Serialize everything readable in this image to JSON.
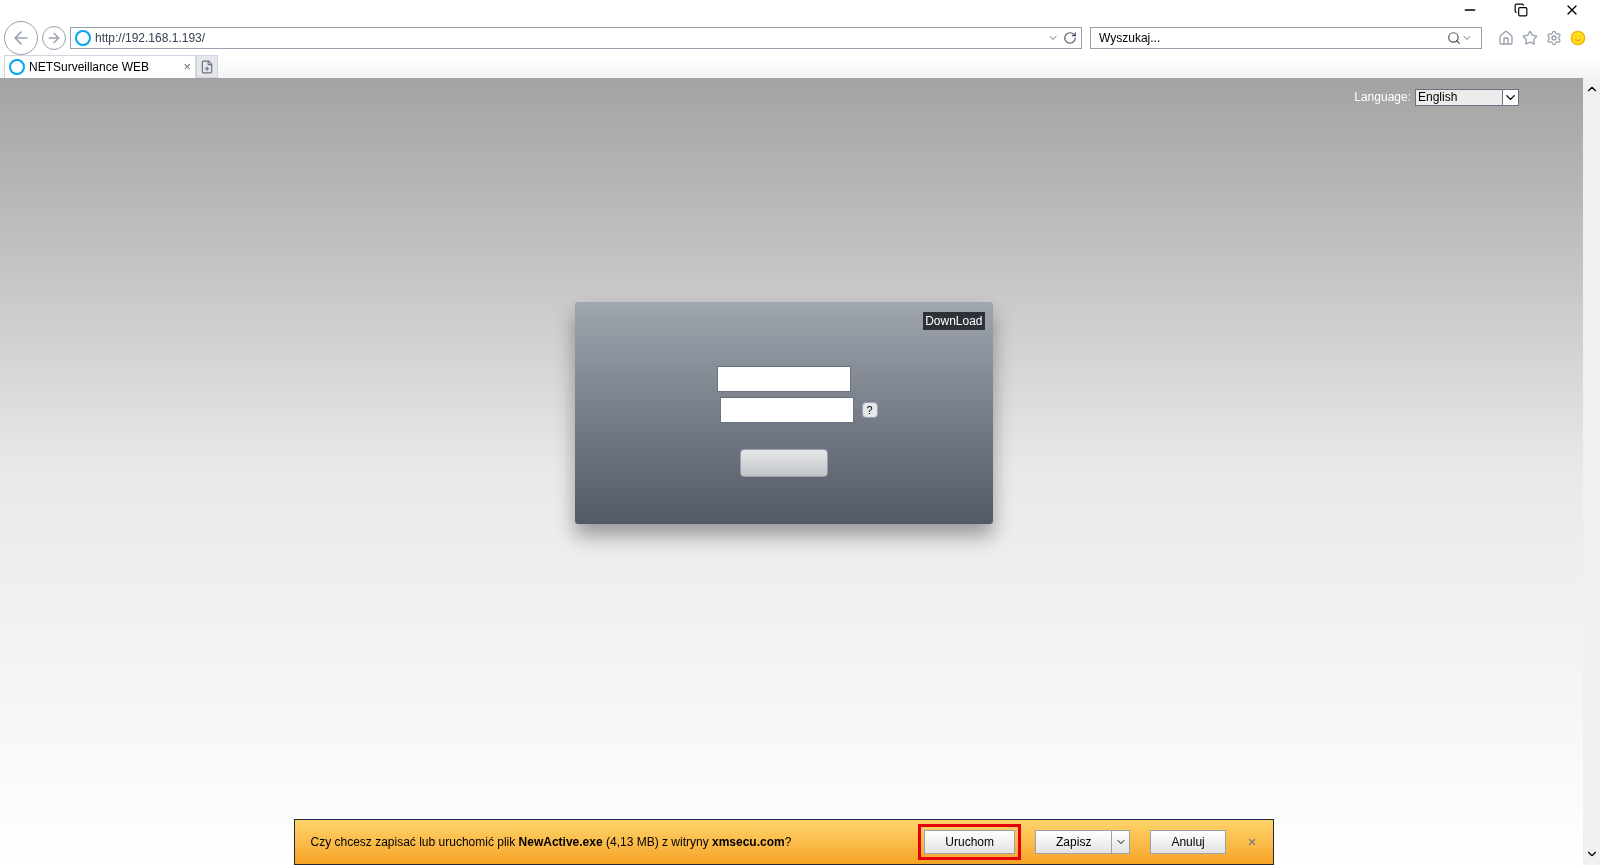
{
  "browser": {
    "address": "http://192.168.1.193/",
    "search": {
      "placeholder": "Wyszukaj..."
    },
    "tabs": [
      {
        "label": "NETSurveillance WEB",
        "selected": true,
        "close": "×"
      }
    ]
  },
  "page": {
    "language": {
      "label": "Language:",
      "value": "English"
    },
    "download": "DownLoad",
    "help": "?"
  },
  "download_bar": {
    "message": "Czy chcesz zapisać lub uruchomić plik **NewActive.exe** (4,13 MB) z witryny **xmsecu.com**?",
    "buttons": [
      {
        "label": "Uruchom",
        "highlighted": true,
        "kind": "plain"
      },
      {
        "label": "Zapisz",
        "highlighted": false,
        "kind": "split"
      },
      {
        "label": "Anuluj",
        "highlighted": false,
        "kind": "plain"
      }
    ],
    "close": "×"
  }
}
